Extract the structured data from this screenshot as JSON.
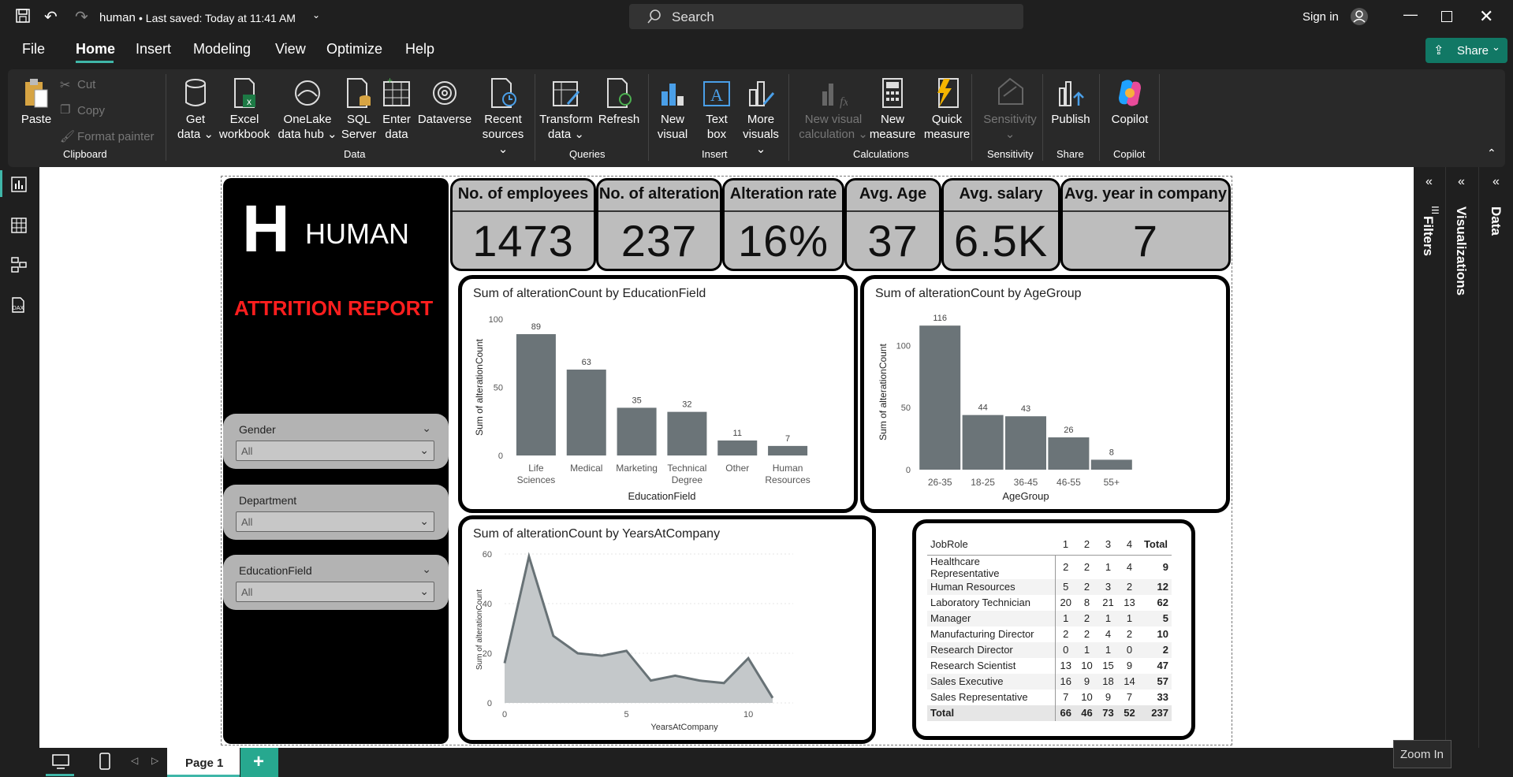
{
  "titlebar": {
    "file_name": "human",
    "saved_status": "• Last saved: Today at 11:41 AM",
    "search_placeholder": "Search",
    "sign_in": "Sign in"
  },
  "menu": {
    "tabs": [
      "File",
      "Home",
      "Insert",
      "Modeling",
      "View",
      "Optimize",
      "Help"
    ],
    "active": "Home",
    "share_label": "Share"
  },
  "ribbon": {
    "clipboard": {
      "paste": "Paste",
      "cut": "Cut",
      "copy": "Copy",
      "format_painter": "Format painter",
      "group": "Clipboard"
    },
    "data": {
      "get_data": [
        "Get",
        "data ⌄"
      ],
      "excel": [
        "Excel",
        "workbook"
      ],
      "onelake": [
        "OneLake",
        "data hub ⌄"
      ],
      "sql": [
        "SQL",
        "Server"
      ],
      "enter": [
        "Enter",
        "data"
      ],
      "dataverse": [
        "Dataverse",
        ""
      ],
      "recent": [
        "Recent",
        "sources ⌄"
      ],
      "group": "Data"
    },
    "queries": {
      "transform": [
        "Transform",
        "data ⌄"
      ],
      "refresh": [
        "Refresh",
        ""
      ],
      "group": "Queries"
    },
    "insert": {
      "new_visual": [
        "New",
        "visual"
      ],
      "text_box": [
        "Text",
        "box"
      ],
      "more_visuals": [
        "More",
        "visuals ⌄"
      ],
      "group": "Insert"
    },
    "calculations": {
      "new_visual_calc": [
        "New visual",
        "calculation ⌄"
      ],
      "new_measure": [
        "New",
        "measure"
      ],
      "quick_measure": [
        "Quick",
        "measure"
      ],
      "group": "Calculations"
    },
    "sensitivity": {
      "label": [
        "Sensitivity",
        "⌄"
      ],
      "group": "Sensitivity"
    },
    "share": {
      "publish": "Publish",
      "group": "Share"
    },
    "copilot": {
      "label": "Copilot",
      "group": "Copilot"
    }
  },
  "report": {
    "logo_letter": "H",
    "logo_text": "HUMAN",
    "subtitle": "ATTRITION REPORT",
    "kpis": [
      {
        "label": "No. of employees",
        "value": "1473"
      },
      {
        "label": "No. of alteration",
        "value": "237"
      },
      {
        "label": "Alteration rate",
        "value": "16%"
      },
      {
        "label": "Avg. Age",
        "value": "37"
      },
      {
        "label": "Avg. salary",
        "value": "6.5K"
      },
      {
        "label": "Avg. year in company",
        "value": "7"
      }
    ],
    "slicers": [
      {
        "title": "Gender",
        "value": "All"
      },
      {
        "title": "Department",
        "value": "All"
      },
      {
        "title": "EducationField",
        "value": "All"
      }
    ]
  },
  "chart_data": [
    {
      "type": "bar",
      "title": "Sum of alterationCount by EducationField",
      "xlabel": "EducationField",
      "ylabel": "Sum of alterationCount",
      "categories": [
        "Life Sciences",
        "Medical",
        "Marketing",
        "Technical Degree",
        "Other",
        "Human Resources"
      ],
      "category_lines": [
        [
          "Life",
          "Sciences"
        ],
        [
          "Medical"
        ],
        [
          "Marketing"
        ],
        [
          "Technical",
          "Degree"
        ],
        [
          "Other"
        ],
        [
          "Human",
          "Resources"
        ]
      ],
      "values": [
        89,
        63,
        35,
        32,
        11,
        7
      ],
      "yticks": [
        0,
        50,
        100
      ],
      "ylim": [
        0,
        100
      ],
      "bar_color": "#6b7478"
    },
    {
      "type": "bar",
      "title": "Sum of alterationCount by AgeGroup",
      "xlabel": "AgeGroup",
      "ylabel": "Sum of alterationCount",
      "categories": [
        "26-35",
        "18-25",
        "36-45",
        "46-55",
        "55+"
      ],
      "values": [
        116,
        44,
        43,
        26,
        8
      ],
      "yticks": [
        0,
        50,
        100
      ],
      "ylim": [
        0,
        125
      ],
      "bar_color": "#6b7478"
    },
    {
      "type": "area",
      "title": "Sum of alterationCount by YearsAtCompany",
      "xlabel": "YearsAtCompany",
      "ylabel": "Sum of alterationCount",
      "x": [
        0,
        1,
        2,
        3,
        4,
        5,
        6,
        7,
        8,
        9,
        10,
        11
      ],
      "y": [
        16,
        59,
        27,
        20,
        19,
        21,
        9,
        11,
        9,
        8,
        18,
        2
      ],
      "xticks": [
        0,
        5,
        10
      ],
      "yticks": [
        0,
        20,
        40,
        60
      ],
      "ylim": [
        0,
        60
      ],
      "fill_color": "#c4c8ca",
      "line_color": "#687276"
    },
    {
      "type": "table",
      "row_header": "JobRole",
      "columns": [
        "1",
        "2",
        "3",
        "4",
        "Total"
      ],
      "rows": [
        {
          "label": "Healthcare Representative",
          "values": [
            2,
            2,
            1,
            4,
            9
          ]
        },
        {
          "label": "Human Resources",
          "values": [
            5,
            2,
            3,
            2,
            12
          ]
        },
        {
          "label": "Laboratory Technician",
          "values": [
            20,
            8,
            21,
            13,
            62
          ]
        },
        {
          "label": "Manager",
          "values": [
            1,
            2,
            1,
            1,
            5
          ]
        },
        {
          "label": "Manufacturing Director",
          "values": [
            2,
            2,
            4,
            2,
            10
          ]
        },
        {
          "label": "Research Director",
          "values": [
            0,
            1,
            1,
            0,
            2
          ]
        },
        {
          "label": "Research Scientist",
          "values": [
            13,
            10,
            15,
            9,
            47
          ]
        },
        {
          "label": "Sales Executive",
          "values": [
            16,
            9,
            18,
            14,
            57
          ]
        },
        {
          "label": "Sales Representative",
          "values": [
            7,
            10,
            9,
            7,
            33
          ]
        }
      ],
      "total": {
        "label": "Total",
        "values": [
          66,
          46,
          73,
          52,
          237
        ]
      }
    }
  ],
  "panes": {
    "filters": "Filters",
    "visualizations": "Visualizations",
    "data": "Data"
  },
  "bottom": {
    "page_tab": "Page 1",
    "add_page": "+",
    "tooltip": "Zoom In"
  }
}
